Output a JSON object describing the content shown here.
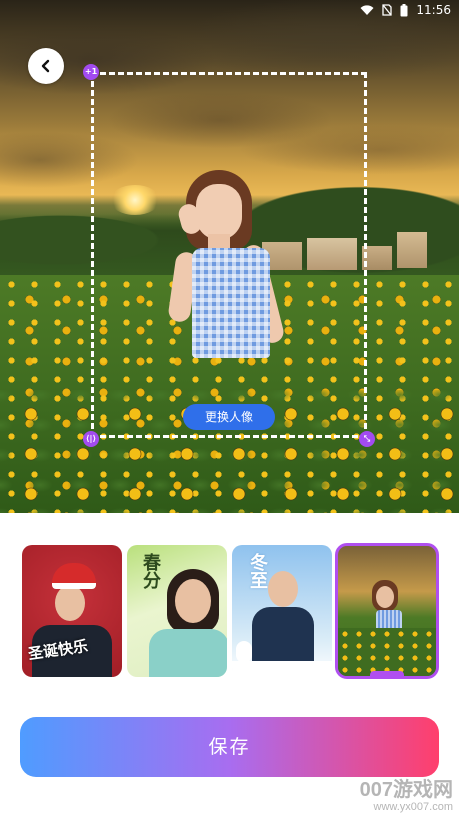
{
  "status_bar": {
    "time": "11:56",
    "icons": [
      "wifi-icon",
      "sim-off-icon",
      "battery-icon"
    ]
  },
  "header": {
    "back_icon": "chevron-left-icon"
  },
  "canvas": {
    "handle_top_left_label": "+1",
    "handle_bottom_left_label": "⟨|⟩",
    "handle_bottom_right_label": "⤡",
    "replace_portrait_label": "更换人像"
  },
  "templates": [
    {
      "name": "christmas",
      "text": "圣诞快乐",
      "selected": false
    },
    {
      "name": "spring",
      "text": "春分",
      "selected": false
    },
    {
      "name": "winter",
      "text": "冬至",
      "selected": false
    },
    {
      "name": "sunflower",
      "text": "",
      "selected": true
    }
  ],
  "actions": {
    "save_label": "保存"
  },
  "watermark": {
    "line1": "007游戏网",
    "line2": "www.yx007.com"
  },
  "colors": {
    "accent_purple": "#b04ff0",
    "replace_button": "#2f6fea",
    "save_gradient_start": "#4f9cff",
    "save_gradient_end": "#ff3f6c"
  }
}
